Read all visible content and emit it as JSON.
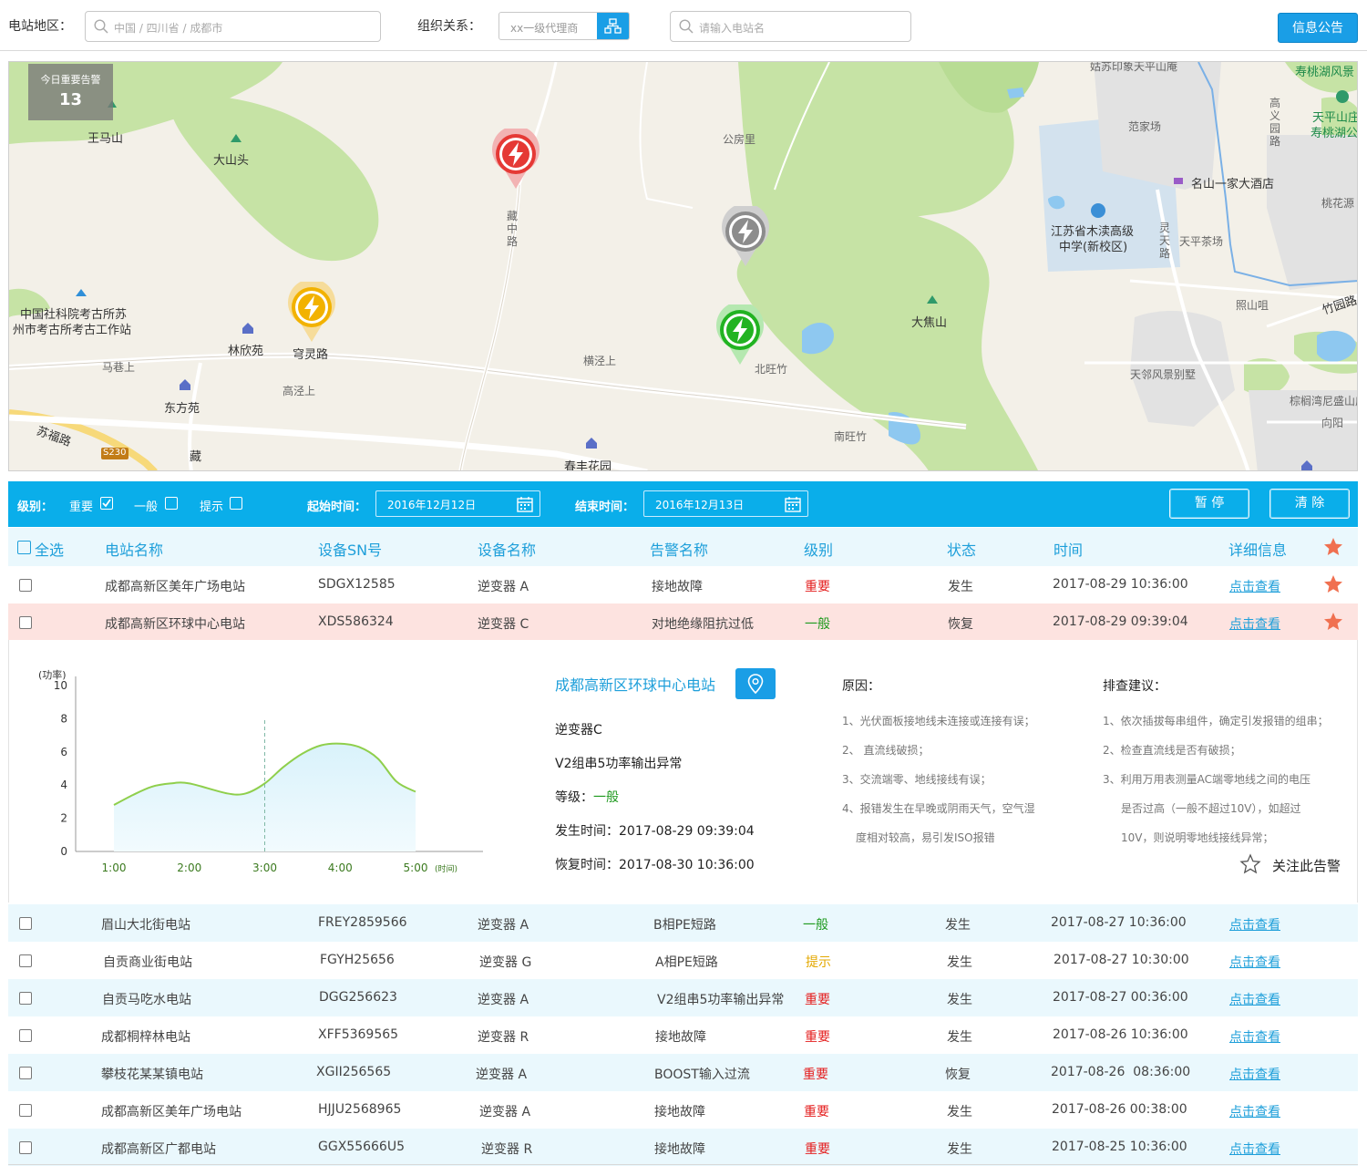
{
  "topbar": {
    "region_label": "电站地区：",
    "region_placeholder": "中国 / 四川省 / 成都市",
    "org_label": "组织关系：",
    "org_placeholder": "xx一级代理商",
    "station_placeholder": "请输入电站名",
    "notice_button": "信息公告"
  },
  "map": {
    "alert_title": "今日重要告警",
    "alert_count": "13",
    "labels": {
      "wangmashan": "王马山",
      "dashantou": "大山头",
      "gongfangli": "公房里",
      "zangzhonglu": "藏中路",
      "archaeology1": "中国社科院考古所苏",
      "archaeology2": "州市考古所考古工作站",
      "linxinyuan": "林欣苑",
      "qionglinglu": "穹灵路",
      "mashangshang": "马巷上",
      "gaojingshang": "高泾上",
      "dongfangyuan": "东方苑",
      "hengjingshang": "横泾上",
      "beiwangzhu": "北旺竹",
      "dajiaoshan": "大焦山",
      "nanwangzhu": "南旺竹",
      "chunfenghuayuan": "春丰花园",
      "sufulu": "苏福路",
      "s230": "S230",
      "zang": "藏",
      "school1": "江苏省木渎高级",
      "school2": "中学(新校区)",
      "fanjiachang": "范家场",
      "hotel": "名山一家大酒店",
      "tianpingchachang": "天平茶场",
      "zhaoshanju": "照山咀",
      "zhugulu": "竹园路",
      "lingtianlu": "灵天路",
      "tianlinvilla": "天邻风景别墅",
      "gaoyiyuanlu": "高义园路",
      "tianpingshan": "天平山庄",
      "shoutaohu": "寿桃湖公",
      "shoutaohu_top": "寿桃湖风景",
      "taohuayuan": "桃花源",
      "xiangyang": "向阳",
      "tongwanni": "棕榈湾尼盛山庄",
      "gusu": "姑苏印象天平山庵"
    }
  },
  "filters": {
    "level_label": "级别：",
    "important": "重要",
    "general": "一般",
    "hint": "提示",
    "start_label": "起始时间：",
    "start_value": "2016年12月12日",
    "end_label": "结束时间：",
    "end_value": "2016年12月13日",
    "pause_button": "暂 停",
    "clear_button": "清 除"
  },
  "table": {
    "select_all": "全选",
    "headers": [
      "电站名称",
      "设备SN号",
      "设备名称",
      "告警名称",
      "级别",
      "状态",
      "时间",
      "详细信息"
    ],
    "rows": [
      {
        "station": "成都高新区美年广场电站",
        "sn": "SDGX12585",
        "device": "逆变器 A",
        "alarm": "接地故障",
        "level": "重要",
        "level_color": "#e41d1d",
        "status": "发生",
        "time": "2017-08-29 10:36:00",
        "detail": "点击查看"
      },
      {
        "station": "成都高新区环球中心电站",
        "sn": "XDS586324",
        "device": "逆变器 C",
        "alarm": "对地绝缘阻抗过低",
        "level": "一般",
        "level_color": "#1f9a1f",
        "status": "恢复",
        "time": "2017-08-29 09:39:04",
        "detail": "点击查看"
      },
      {
        "station": "眉山大北街电站",
        "sn": "FREY2859566",
        "device": "逆变器 A",
        "alarm": "B相PE短路",
        "level": "一般",
        "level_color": "#1f9a1f",
        "status": "发生",
        "time": "2017-08-27 10:36:00",
        "detail": "点击查看"
      },
      {
        "station": "自贡商业街电站",
        "sn": "FGYH25656",
        "device": "逆变器 G",
        "alarm": "A相PE短路",
        "level": "提示",
        "level_color": "#e3a800",
        "status": "发生",
        "time": "2017-08-27 10:30:00",
        "detail": "点击查看"
      },
      {
        "station": "自贡马吃水电站",
        "sn": "DGG256623",
        "device": "逆变器 A",
        "alarm": "V2组串5功率输出异常",
        "level": "重要",
        "level_color": "#e41d1d",
        "status": "发生",
        "time": "2017-08-27 00:36:00",
        "detail": "点击查看"
      },
      {
        "station": "成都桐梓林电站",
        "sn": "XFF5369565",
        "device": "逆变器 R",
        "alarm": "接地故障",
        "level": "重要",
        "level_color": "#e41d1d",
        "status": "发生",
        "time": "2017-08-26 10:36:00",
        "detail": "点击查看"
      },
      {
        "station": "攀枝花某某镇电站",
        "sn": "XGII256565",
        "device": "逆变器 A",
        "alarm": "BOOST输入过流",
        "level": "重要",
        "level_color": "#e41d1d",
        "status": "恢复",
        "time": "2017-08-26  08:36:00",
        "detail": "点击查看"
      },
      {
        "station": "成都高新区美年广场电站",
        "sn": "HJJU2568965",
        "device": "逆变器 A",
        "alarm": "接地故障",
        "level": "重要",
        "level_color": "#e41d1d",
        "status": "发生",
        "time": "2017-08-26 00:38:00",
        "detail": "点击查看"
      },
      {
        "station": "成都高新区广都电站",
        "sn": "GGX55666U5",
        "device": "逆变器 R",
        "alarm": "接地故障",
        "level": "重要",
        "level_color": "#e41d1d",
        "status": "发生",
        "time": "2017-08-25 10:36:00",
        "detail": "点击查看"
      }
    ]
  },
  "detail": {
    "station": "成都高新区环球中心电站",
    "device": "逆变器C",
    "alarm": "V2组串5功率输出异常",
    "level_label": "等级：",
    "level_value": "一般",
    "occur": "发生时间：2017-08-29 09:39:04",
    "recover": "恢复时间：2017-08-30 10:36:00",
    "reason_title": "原因：",
    "reasons": [
      "1、光伏面板接地线未连接或连接有误；",
      "2、 直流线破损；",
      "3、交流端零、地线接线有误；",
      "4、报错发生在早晚或阴雨天气，空气湿",
      "度相对较高，易引发ISO报错"
    ],
    "advice_title": "排查建议：",
    "advices": [
      "1、依次插拔每串组件，确定引发报错的组串；",
      "2、检查直流线是否有破损；",
      "3、利用万用表测量AC端零地线之间的电压",
      "是否过高（一般不超过10V），如超过",
      "10V，则说明零地线接线异常；"
    ],
    "follow_label": "关注此告警"
  },
  "chart_data": {
    "type": "area",
    "ylabel": "(功率)",
    "xlabel": "(时间)",
    "x": [
      "1:00",
      "2:00",
      "3:00",
      "4:00",
      "5:00"
    ],
    "xnum": [
      1.0,
      1.25,
      1.5,
      1.75,
      2.0,
      2.5,
      2.75,
      3.0,
      3.25,
      3.5,
      3.75,
      4.0,
      4.25,
      4.5,
      4.75,
      5.0
    ],
    "y": [
      2.8,
      3.4,
      3.9,
      4.1,
      4.1,
      3.5,
      3.5,
      4.1,
      5.1,
      5.9,
      6.4,
      6.5,
      6.3,
      5.6,
      4.2,
      3.6
    ],
    "ylim": [
      0,
      10
    ],
    "yticks": [
      "0",
      "2",
      "4",
      "6",
      "8",
      "10"
    ],
    "marker_x": 3.0,
    "color": "#8fcf4c"
  }
}
